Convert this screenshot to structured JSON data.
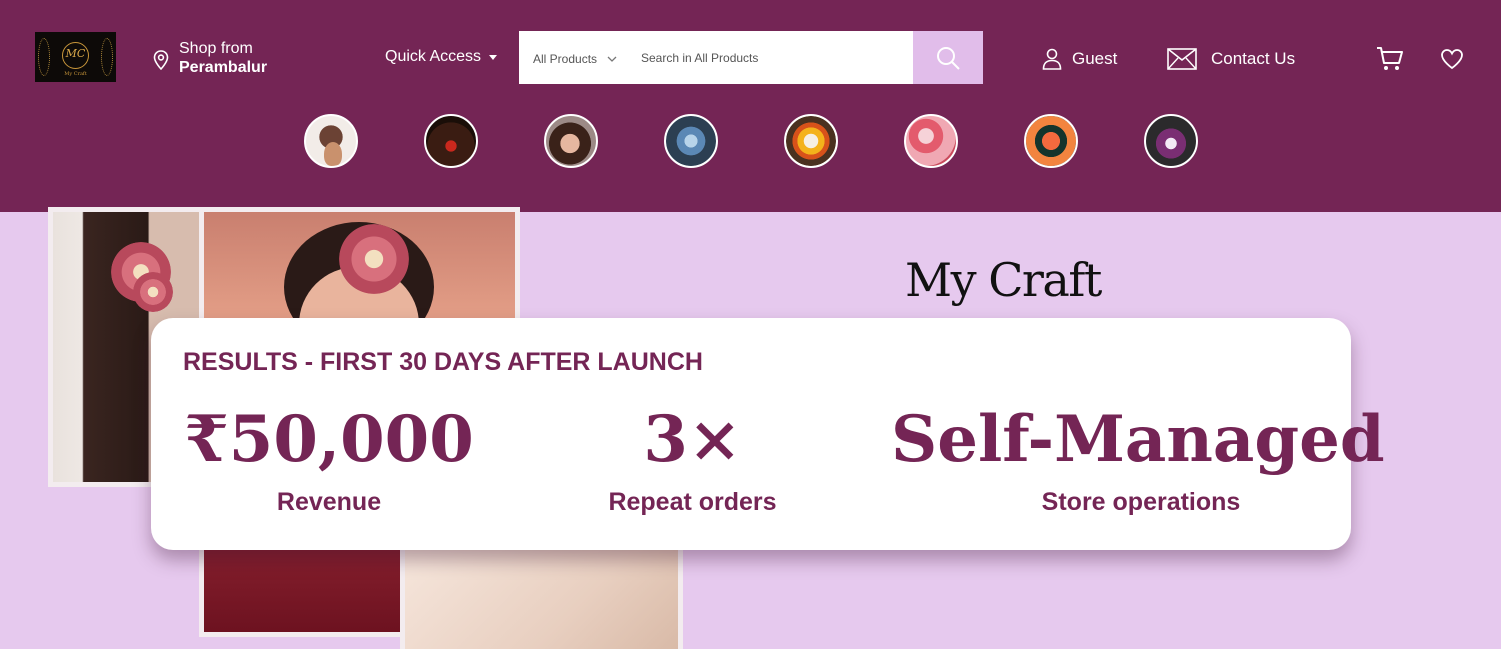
{
  "header": {
    "logo_text": "MC",
    "logo_sub": "My Craft",
    "location_prefix": "Shop from",
    "location_city": "Perambalur",
    "quick_access": "Quick Access",
    "search": {
      "category": "All Products",
      "placeholder": "Search in All Products"
    },
    "guest": "Guest",
    "contact": "Contact Us"
  },
  "categories": [
    {
      "name": "kids-hair-accessories"
    },
    {
      "name": "candles"
    },
    {
      "name": "hair-clips"
    },
    {
      "name": "blue-flowers"
    },
    {
      "name": "yellow-flowers"
    },
    {
      "name": "pink-flowers"
    },
    {
      "name": "orange-flowers"
    },
    {
      "name": "purple-flowers"
    }
  ],
  "hero": {
    "brand": "My Craft"
  },
  "results": {
    "heading": "RESULTS - FIRST 30 DAYS AFTER LAUNCH",
    "stats": [
      {
        "value": "₹50,000",
        "label": "Revenue"
      },
      {
        "value": "3×",
        "label": "Repeat orders"
      },
      {
        "value": "Self-Managed",
        "label": "Store operations"
      }
    ]
  },
  "colors": {
    "header_bg": "#742555",
    "hero_bg": "#e6c9ee",
    "search_button": "#e1bdea",
    "accent_text": "#742555"
  }
}
